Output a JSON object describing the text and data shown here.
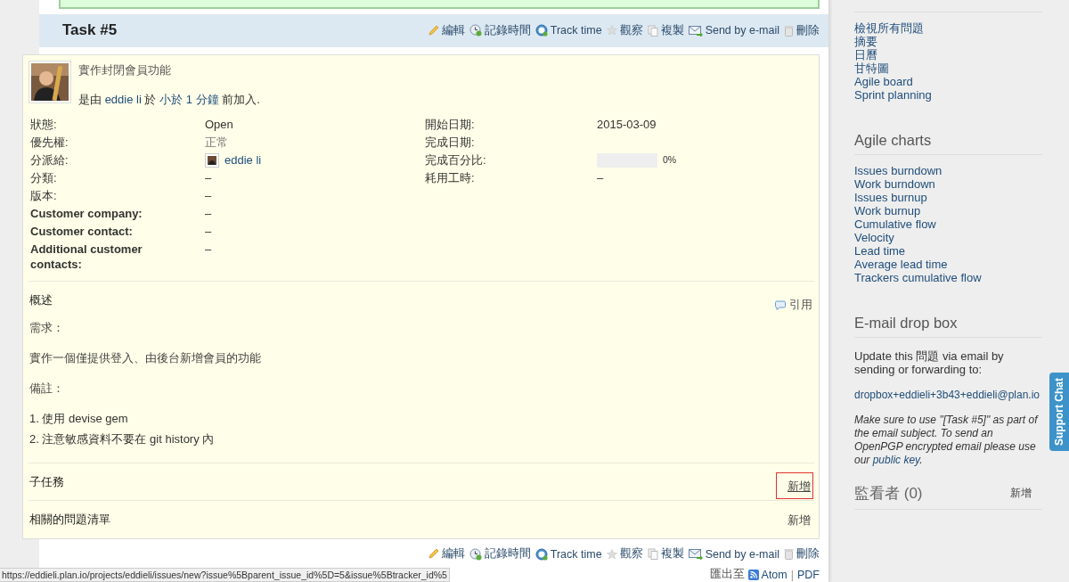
{
  "issue": {
    "title": "Task #5",
    "bottom_actions": [
      {
        "kind": "edit",
        "label": "編輯"
      },
      {
        "kind": "log",
        "label": "記錄時間"
      },
      {
        "kind": "track",
        "label": "Track time"
      },
      {
        "kind": "watch",
        "label": "觀察"
      },
      {
        "kind": "copy",
        "label": "複製"
      },
      {
        "kind": "email",
        "label": "Send by e-mail"
      },
      {
        "kind": "delete",
        "label": "刪除"
      }
    ],
    "actions": [
      {
        "kind": "edit",
        "label": "編輯"
      },
      {
        "kind": "log",
        "label": "記錄時間"
      },
      {
        "kind": "track",
        "label": "Track time"
      },
      {
        "kind": "watch",
        "label": "觀察"
      },
      {
        "kind": "copy",
        "label": "複製"
      },
      {
        "kind": "email",
        "label": "Send by e-mail"
      },
      {
        "kind": "delete",
        "label": "刪除"
      }
    ],
    "subject": "實作封閉會員功能",
    "author_line": {
      "prefix": "是由",
      "author": "eddie li",
      "mid": "於",
      "age": "小於 1 分鐘",
      "suffix": "前加入."
    },
    "attributes_left": [
      {
        "label": "狀態:",
        "kind": "text",
        "value": "Open",
        "custom": false
      },
      {
        "label": "優先權:",
        "kind": "muted",
        "value": "正常",
        "custom": false
      },
      {
        "label": "分派給:",
        "kind": "user",
        "value": "eddie li",
        "custom": false
      },
      {
        "label": "分類:",
        "kind": "text",
        "value": "–",
        "custom": false
      },
      {
        "label": "版本:",
        "kind": "text",
        "value": "–",
        "custom": false
      },
      {
        "label": "Customer company:",
        "kind": "text",
        "value": "–",
        "custom": true
      },
      {
        "label": "Customer contact:",
        "kind": "text",
        "value": "–",
        "custom": true
      },
      {
        "label": "Additional customer contacts:",
        "kind": "text",
        "value": "–",
        "custom": true
      }
    ],
    "attributes_right": [
      {
        "label": "開始日期:",
        "kind": "text",
        "value": "2015-03-09",
        "custom": false
      },
      {
        "label": "完成日期:",
        "kind": "empty",
        "custom": false
      },
      {
        "label": "完成百分比:",
        "kind": "progress",
        "level": 0,
        "value": "0%",
        "custom": false
      },
      {
        "label": "耗用工時:",
        "kind": "text",
        "value": "–",
        "custom": false
      }
    ],
    "description": {
      "heading": "概述",
      "quote": "引用",
      "lines": [
        {
          "kind": "para",
          "text": "需求："
        },
        {
          "kind": "para",
          "text": "實作一個僅提供登入、由後台新增會員的功能"
        },
        {
          "kind": "para",
          "text": "備註："
        },
        {
          "kind": "list",
          "text": "1. 使用 devise gem"
        },
        {
          "kind": "list",
          "text": "2. 注意敏感資料不要在 git history 內"
        }
      ]
    },
    "sections": [
      {
        "heading": "子任務",
        "link": "新增",
        "highlighted": true
      },
      {
        "heading": "相關的問題清單",
        "link": "新增",
        "highlighted": false
      }
    ],
    "export": {
      "label": "匯出至",
      "formats": [
        "Atom",
        "PDF"
      ],
      "separator": "|"
    }
  },
  "status_bar": {
    "url": "https://eddieli.plan.io/projects/eddieli/issues/new?issue%5Bparent_issue_id%5D=5&issue%5Btracker_id%5"
  },
  "sidebar": {
    "issue_links": [
      "檢視所有問題",
      "摘要",
      "日曆",
      "甘特圖",
      "Agile board",
      "Sprint planning"
    ],
    "agile_charts": {
      "heading": "Agile charts",
      "links": [
        "Issues burndown",
        "Work burndown",
        "Issues burnup",
        "Work burnup",
        "Cumulative flow",
        "Velocity",
        "Lead time",
        "Average lead time",
        "Trackers cumulative flow"
      ]
    },
    "email_drop_box": {
      "heading": "E-mail drop box",
      "text": "Update this 問題 via email by sending or forwarding to:",
      "address": "dropbox+eddieli+3b43+eddieli@plan.io",
      "note": "Make sure to use \"[Task #5]\" as part of the email subject. To send an OpenPGP encrypted email please use our",
      "note_link": "public key",
      "note_end": "."
    },
    "watchers": {
      "heading": "監看者 (0)",
      "link": "新增"
    }
  },
  "support_chat": {
    "label": "Support Chat"
  }
}
